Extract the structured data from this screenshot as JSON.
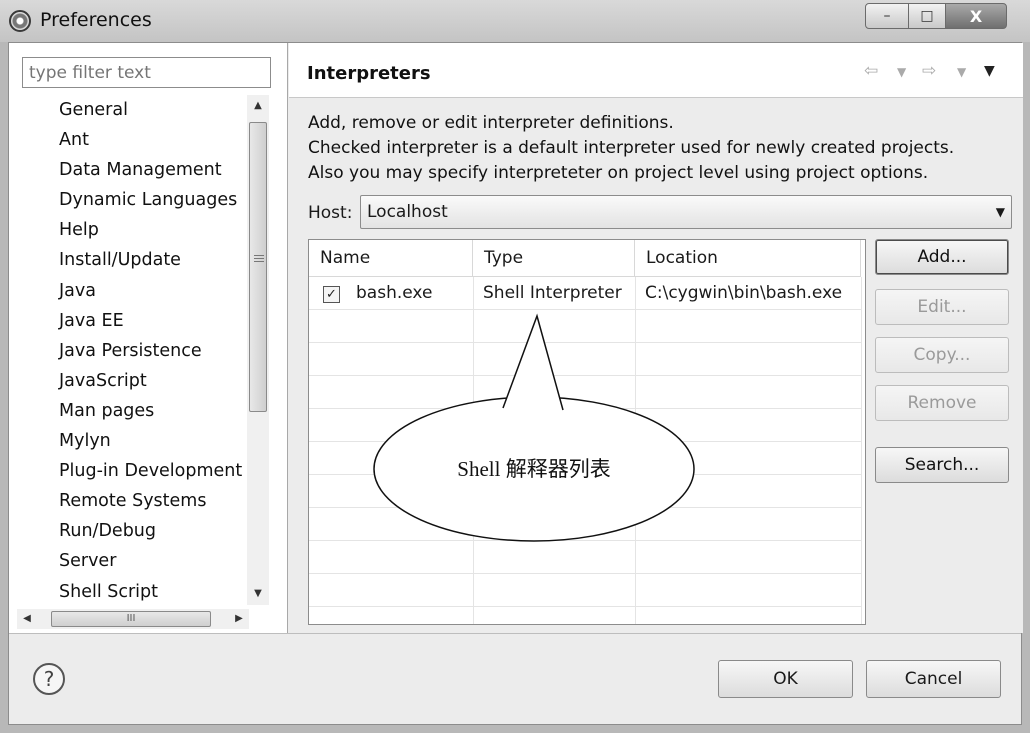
{
  "window": {
    "title": "Preferences",
    "min_glyph": "–",
    "max_glyph": "□",
    "close_glyph": "X"
  },
  "filter": {
    "placeholder": "type filter text"
  },
  "tree": {
    "items": [
      "General",
      "Ant",
      "Data Management",
      "Dynamic Languages",
      "Help",
      "Install/Update",
      "Java",
      "Java EE",
      "Java Persistence",
      "JavaScript",
      "Man pages",
      "Mylyn",
      "Plug-in Development",
      "Remote Systems",
      "Run/Debug",
      "Server",
      "Shell Script"
    ],
    "hscroll_thumb_glyph": "III"
  },
  "page": {
    "title": "Interpreters",
    "description": [
      "Add, remove or edit interpreter definitions.",
      "Checked interpreter is a default interpreter used for newly created projects.",
      "Also you may specify interpreteter on project level using project options."
    ],
    "host_label": "Host:",
    "host_value": "Localhost"
  },
  "table": {
    "columns": [
      "Name",
      "Type",
      "Location"
    ],
    "rows": [
      {
        "checked": true,
        "name": "bash.exe",
        "type": "Shell Interpreter",
        "location": "C:\\cygwin\\bin\\bash.exe"
      }
    ]
  },
  "buttons": {
    "add": "Add...",
    "edit": "Edit...",
    "copy": "Copy...",
    "remove": "Remove",
    "search": "Search..."
  },
  "callout": {
    "text": "Shell 解释器列表"
  },
  "footer": {
    "ok": "OK",
    "cancel": "Cancel",
    "help_glyph": "?"
  }
}
